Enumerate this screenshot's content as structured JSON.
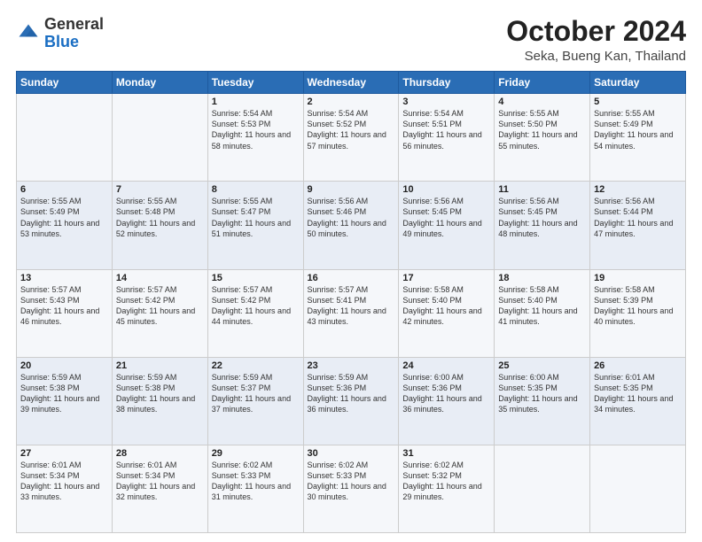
{
  "header": {
    "logo_line1": "General",
    "logo_line2": "Blue",
    "month": "October 2024",
    "location": "Seka, Bueng Kan, Thailand"
  },
  "weekdays": [
    "Sunday",
    "Monday",
    "Tuesday",
    "Wednesday",
    "Thursday",
    "Friday",
    "Saturday"
  ],
  "weeks": [
    [
      {
        "day": "",
        "sunrise": "",
        "sunset": "",
        "daylight": ""
      },
      {
        "day": "",
        "sunrise": "",
        "sunset": "",
        "daylight": ""
      },
      {
        "day": "1",
        "sunrise": "Sunrise: 5:54 AM",
        "sunset": "Sunset: 5:53 PM",
        "daylight": "Daylight: 11 hours and 58 minutes."
      },
      {
        "day": "2",
        "sunrise": "Sunrise: 5:54 AM",
        "sunset": "Sunset: 5:52 PM",
        "daylight": "Daylight: 11 hours and 57 minutes."
      },
      {
        "day": "3",
        "sunrise": "Sunrise: 5:54 AM",
        "sunset": "Sunset: 5:51 PM",
        "daylight": "Daylight: 11 hours and 56 minutes."
      },
      {
        "day": "4",
        "sunrise": "Sunrise: 5:55 AM",
        "sunset": "Sunset: 5:50 PM",
        "daylight": "Daylight: 11 hours and 55 minutes."
      },
      {
        "day": "5",
        "sunrise": "Sunrise: 5:55 AM",
        "sunset": "Sunset: 5:49 PM",
        "daylight": "Daylight: 11 hours and 54 minutes."
      }
    ],
    [
      {
        "day": "6",
        "sunrise": "Sunrise: 5:55 AM",
        "sunset": "Sunset: 5:49 PM",
        "daylight": "Daylight: 11 hours and 53 minutes."
      },
      {
        "day": "7",
        "sunrise": "Sunrise: 5:55 AM",
        "sunset": "Sunset: 5:48 PM",
        "daylight": "Daylight: 11 hours and 52 minutes."
      },
      {
        "day": "8",
        "sunrise": "Sunrise: 5:55 AM",
        "sunset": "Sunset: 5:47 PM",
        "daylight": "Daylight: 11 hours and 51 minutes."
      },
      {
        "day": "9",
        "sunrise": "Sunrise: 5:56 AM",
        "sunset": "Sunset: 5:46 PM",
        "daylight": "Daylight: 11 hours and 50 minutes."
      },
      {
        "day": "10",
        "sunrise": "Sunrise: 5:56 AM",
        "sunset": "Sunset: 5:45 PM",
        "daylight": "Daylight: 11 hours and 49 minutes."
      },
      {
        "day": "11",
        "sunrise": "Sunrise: 5:56 AM",
        "sunset": "Sunset: 5:45 PM",
        "daylight": "Daylight: 11 hours and 48 minutes."
      },
      {
        "day": "12",
        "sunrise": "Sunrise: 5:56 AM",
        "sunset": "Sunset: 5:44 PM",
        "daylight": "Daylight: 11 hours and 47 minutes."
      }
    ],
    [
      {
        "day": "13",
        "sunrise": "Sunrise: 5:57 AM",
        "sunset": "Sunset: 5:43 PM",
        "daylight": "Daylight: 11 hours and 46 minutes."
      },
      {
        "day": "14",
        "sunrise": "Sunrise: 5:57 AM",
        "sunset": "Sunset: 5:42 PM",
        "daylight": "Daylight: 11 hours and 45 minutes."
      },
      {
        "day": "15",
        "sunrise": "Sunrise: 5:57 AM",
        "sunset": "Sunset: 5:42 PM",
        "daylight": "Daylight: 11 hours and 44 minutes."
      },
      {
        "day": "16",
        "sunrise": "Sunrise: 5:57 AM",
        "sunset": "Sunset: 5:41 PM",
        "daylight": "Daylight: 11 hours and 43 minutes."
      },
      {
        "day": "17",
        "sunrise": "Sunrise: 5:58 AM",
        "sunset": "Sunset: 5:40 PM",
        "daylight": "Daylight: 11 hours and 42 minutes."
      },
      {
        "day": "18",
        "sunrise": "Sunrise: 5:58 AM",
        "sunset": "Sunset: 5:40 PM",
        "daylight": "Daylight: 11 hours and 41 minutes."
      },
      {
        "day": "19",
        "sunrise": "Sunrise: 5:58 AM",
        "sunset": "Sunset: 5:39 PM",
        "daylight": "Daylight: 11 hours and 40 minutes."
      }
    ],
    [
      {
        "day": "20",
        "sunrise": "Sunrise: 5:59 AM",
        "sunset": "Sunset: 5:38 PM",
        "daylight": "Daylight: 11 hours and 39 minutes."
      },
      {
        "day": "21",
        "sunrise": "Sunrise: 5:59 AM",
        "sunset": "Sunset: 5:38 PM",
        "daylight": "Daylight: 11 hours and 38 minutes."
      },
      {
        "day": "22",
        "sunrise": "Sunrise: 5:59 AM",
        "sunset": "Sunset: 5:37 PM",
        "daylight": "Daylight: 11 hours and 37 minutes."
      },
      {
        "day": "23",
        "sunrise": "Sunrise: 5:59 AM",
        "sunset": "Sunset: 5:36 PM",
        "daylight": "Daylight: 11 hours and 36 minutes."
      },
      {
        "day": "24",
        "sunrise": "Sunrise: 6:00 AM",
        "sunset": "Sunset: 5:36 PM",
        "daylight": "Daylight: 11 hours and 36 minutes."
      },
      {
        "day": "25",
        "sunrise": "Sunrise: 6:00 AM",
        "sunset": "Sunset: 5:35 PM",
        "daylight": "Daylight: 11 hours and 35 minutes."
      },
      {
        "day": "26",
        "sunrise": "Sunrise: 6:01 AM",
        "sunset": "Sunset: 5:35 PM",
        "daylight": "Daylight: 11 hours and 34 minutes."
      }
    ],
    [
      {
        "day": "27",
        "sunrise": "Sunrise: 6:01 AM",
        "sunset": "Sunset: 5:34 PM",
        "daylight": "Daylight: 11 hours and 33 minutes."
      },
      {
        "day": "28",
        "sunrise": "Sunrise: 6:01 AM",
        "sunset": "Sunset: 5:34 PM",
        "daylight": "Daylight: 11 hours and 32 minutes."
      },
      {
        "day": "29",
        "sunrise": "Sunrise: 6:02 AM",
        "sunset": "Sunset: 5:33 PM",
        "daylight": "Daylight: 11 hours and 31 minutes."
      },
      {
        "day": "30",
        "sunrise": "Sunrise: 6:02 AM",
        "sunset": "Sunset: 5:33 PM",
        "daylight": "Daylight: 11 hours and 30 minutes."
      },
      {
        "day": "31",
        "sunrise": "Sunrise: 6:02 AM",
        "sunset": "Sunset: 5:32 PM",
        "daylight": "Daylight: 11 hours and 29 minutes."
      },
      {
        "day": "",
        "sunrise": "",
        "sunset": "",
        "daylight": ""
      },
      {
        "day": "",
        "sunrise": "",
        "sunset": "",
        "daylight": ""
      }
    ]
  ]
}
